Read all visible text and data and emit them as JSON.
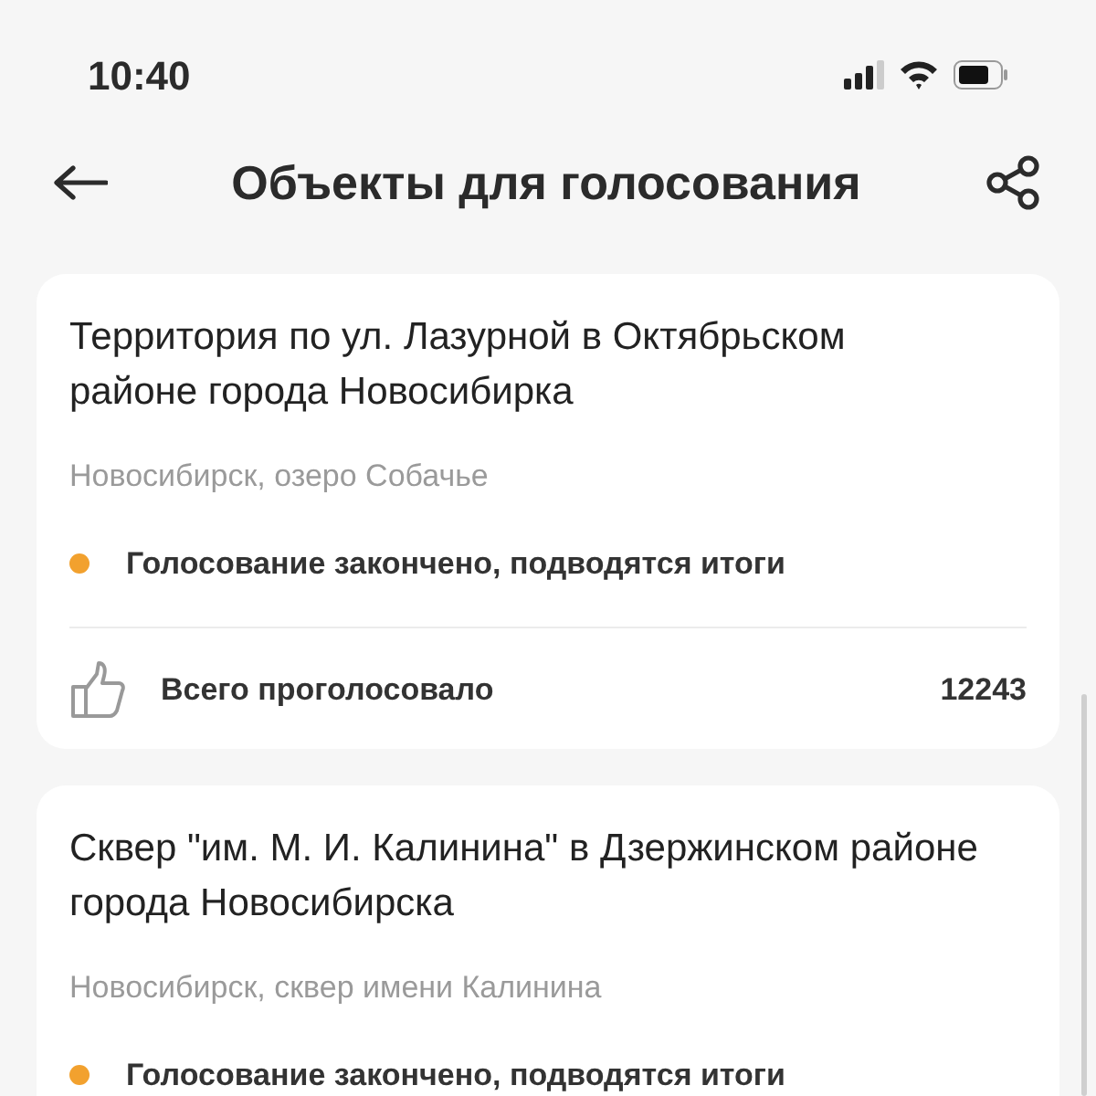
{
  "status_bar": {
    "time": "10:40"
  },
  "header": {
    "title": "Объекты для голосования"
  },
  "objects": [
    {
      "title": "Территория по ул. Лазурной в Октябрьском районе города Новосибирка",
      "location": "Новосибирск, озеро Собачье",
      "status": {
        "text": "Голосование закончено, подводятся итоги",
        "color": "#f2a12e"
      },
      "votes": {
        "label": "Всего проголосовало",
        "count": "12243"
      }
    },
    {
      "title": "Сквер \"им. М. И. Калинина\" в Дзержинском районе города Новосибирска",
      "location": "Новосибирск, сквер имени Калинина",
      "status": {
        "text": "Голосование закончено, подводятся итоги",
        "color": "#f2a12e"
      }
    }
  ]
}
